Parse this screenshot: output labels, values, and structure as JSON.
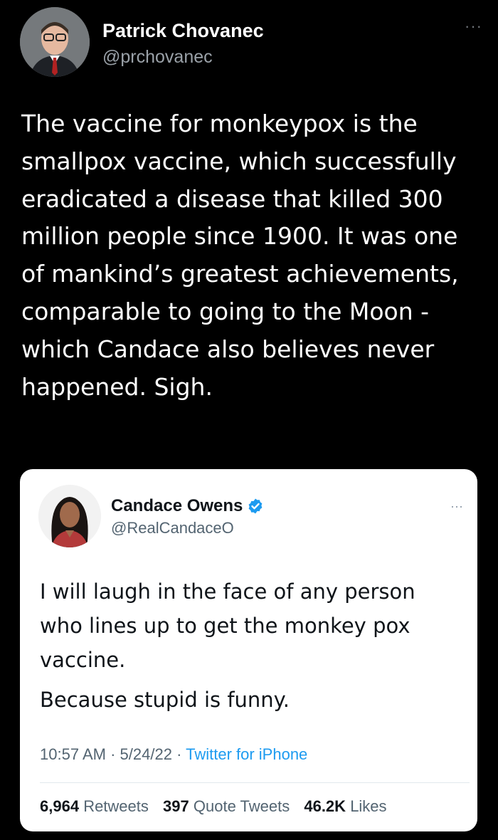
{
  "outer_tweet": {
    "author_name": "Patrick Chovanec",
    "author_handle": "@prchovanec",
    "more_label": "···",
    "text": "The vaccine for monkeypox is the smallpox vaccine, which successfully eradicated a disease that killed 300 million people since 1900. It was one of mankind’s greatest achievements, comparable to going to the Moon - which Candace also believes never happened. Sigh."
  },
  "quoted_tweet": {
    "author_name": "Candace Owens",
    "author_handle": "@RealCandaceO",
    "verified": true,
    "more_label": "···",
    "text_paragraph_1": "I will laugh in the face of any person who lines up to get the monkey pox vaccine.",
    "text_paragraph_2": "Because stupid is funny.",
    "time": "10:57 AM",
    "date": "5/24/22",
    "source": "Twitter for iPhone",
    "separator": "·",
    "stats": {
      "retweets_count": "6,964",
      "retweets_label": "Retweets",
      "quotes_count": "397",
      "quotes_label": "Quote Tweets",
      "likes_count": "46.2K",
      "likes_label": "Likes"
    }
  },
  "colors": {
    "background": "#000000",
    "card_background": "#ffffff",
    "link": "#1d9bf0",
    "verified": "#1d9bf0",
    "secondary_text_dark": "#9aa1a8",
    "secondary_text_light": "#536471"
  }
}
